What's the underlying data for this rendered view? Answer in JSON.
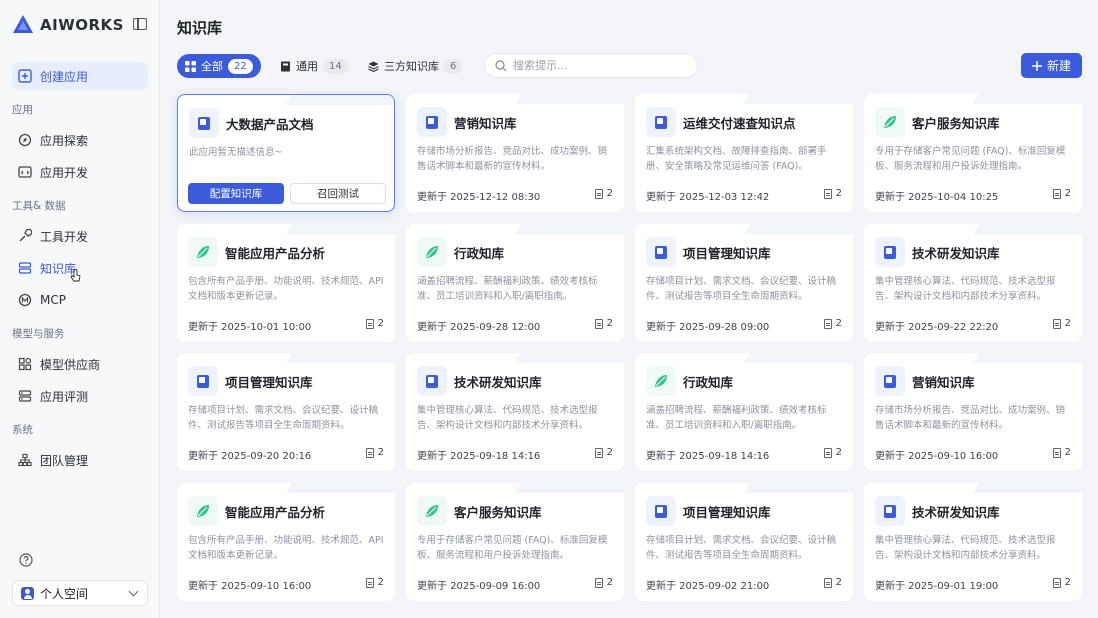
{
  "brand": {
    "name": "AIWORKS"
  },
  "sidebar": {
    "create_label": "创建应用",
    "sections": [
      {
        "label": "应用",
        "items": [
          {
            "label": "应用探索",
            "icon": "compass-icon"
          },
          {
            "label": "应用开发",
            "icon": "code-window-icon"
          }
        ]
      },
      {
        "label": "工具& 数据",
        "items": [
          {
            "label": "工具开发",
            "icon": "tool-icon"
          },
          {
            "label": "知识库",
            "icon": "database-icon",
            "active": true
          },
          {
            "label": "MCP",
            "icon": "mcp-icon"
          }
        ]
      },
      {
        "label": "模型与服务",
        "items": [
          {
            "label": "模型供应商",
            "icon": "grid-icon"
          },
          {
            "label": "应用评测",
            "icon": "evaluation-icon"
          }
        ]
      },
      {
        "label": "系统",
        "items": [
          {
            "label": "团队管理",
            "icon": "team-icon"
          }
        ]
      }
    ],
    "space_label": "个人空间"
  },
  "header": {
    "title": "知识库"
  },
  "filters": [
    {
      "label": "全部",
      "count": "22",
      "active": true
    },
    {
      "label": "通用",
      "count": "14"
    },
    {
      "label": "三方知识库",
      "count": "6"
    }
  ],
  "search": {
    "placeholder": "搜索提示..."
  },
  "new_button": "新建",
  "cards": [
    {
      "title": "大数据产品文档",
      "desc": "此应用暂无描述信息~",
      "icon": "doc",
      "selected": true,
      "btn_config": "配置知识库",
      "btn_test": "召回测试"
    },
    {
      "title": "营销知识库",
      "desc": "存储市场分析报告、竞品对比、成功案例、销售话术脚本和最新的宣传材料。",
      "icon": "doc",
      "updated": "更新于 2025-12-12 08:30",
      "count": "2"
    },
    {
      "title": "运维交付速查知识点",
      "desc": "汇集系统架构文档、故障排查指南、部署手册、安全策略及常见运维问答 (FAQ)。",
      "icon": "doc",
      "updated": "更新于 2025-12-03 12:42",
      "count": "2"
    },
    {
      "title": "客户服务知识库",
      "desc": "专用于存储客户常见问题 (FAQ)、标准回复模板、服务流程和用户投诉处理指南。",
      "icon": "leaf",
      "updated": "更新于 2025-10-04 10:25",
      "count": "2"
    },
    {
      "title": "智能应用产品分析",
      "desc": "包含所有产品手册、功能说明、技术规范、API 文档和版本更新记录。",
      "icon": "leaf",
      "updated": "更新于 2025-10-01 10:00",
      "count": "2"
    },
    {
      "title": "行政知库",
      "desc": "涵盖招聘流程、薪酬福利政策、绩效考核标准、员工培训资料和入职/离职指南。",
      "icon": "leaf",
      "updated": "更新于 2025-09-28 12:00",
      "count": "2"
    },
    {
      "title": "项目管理知识库",
      "desc": "存储项目计划、需求文档、会议纪要、设计稿件、测试报告等项目全生命周期资料。",
      "icon": "doc",
      "updated": "更新于 2025-09-28 09:00",
      "count": "2"
    },
    {
      "title": "技术研发知识库",
      "desc": "集中管理核心算法、代码规范、技术选型报告、架构设计文档和内部技术分享资料。",
      "icon": "doc",
      "updated": "更新于 2025-09-22 22:20",
      "count": "2"
    },
    {
      "title": "项目管理知识库",
      "desc": "存储项目计划、需求文档、会议纪要、设计稿件、测试报告等项目全生命周期资料。",
      "icon": "doc",
      "updated": "更新于 2025-09-20 20:16",
      "count": "2"
    },
    {
      "title": "技术研发知识库",
      "desc": "集中管理核心算法、代码规范、技术选型报告、架构设计文档和内部技术分享资料。",
      "icon": "doc",
      "updated": "更新于 2025-09-18 14:16",
      "count": "2"
    },
    {
      "title": "行政知库",
      "desc": "涵盖招聘流程、薪酬福利政策、绩效考核标准、员工培训资料和入职/离职指南。",
      "icon": "leaf",
      "updated": "更新于 2025-09-18 14:16",
      "count": "2"
    },
    {
      "title": "营销知识库",
      "desc": "存储市场分析报告、竞品对比、成功案例、销售话术脚本和最新的宣传材料。",
      "icon": "doc",
      "updated": "更新于 2025-09-10 16:00",
      "count": "2"
    },
    {
      "title": "智能应用产品分析",
      "desc": "包含所有产品手册、功能说明、技术规范、API 文档和版本更新记录。",
      "icon": "leaf",
      "updated": "更新于 2025-09-10 16:00",
      "count": "2"
    },
    {
      "title": "客户服务知识库",
      "desc": "专用于存储客户常见问题 (FAQ)、标准回复模板、服务流程和用户投诉处理指南。",
      "icon": "leaf",
      "updated": "更新于 2025-09-09 16:00",
      "count": "2"
    },
    {
      "title": "项目管理知识库",
      "desc": "存储项目计划、需求文档、会议纪要、设计稿件、测试报告等项目全生命周期资料。",
      "icon": "doc",
      "updated": "更新于 2025-09-02 21:00",
      "count": "2"
    },
    {
      "title": "技术研发知识库",
      "desc": "集中管理核心算法、代码规范、技术选型报告、架构设计文档和内部技术分享资料。",
      "icon": "doc",
      "updated": "更新于 2025-09-01 19:00",
      "count": "2"
    }
  ],
  "colors": {
    "accent": "#3b5bdb",
    "background": "#f2f4f8"
  }
}
